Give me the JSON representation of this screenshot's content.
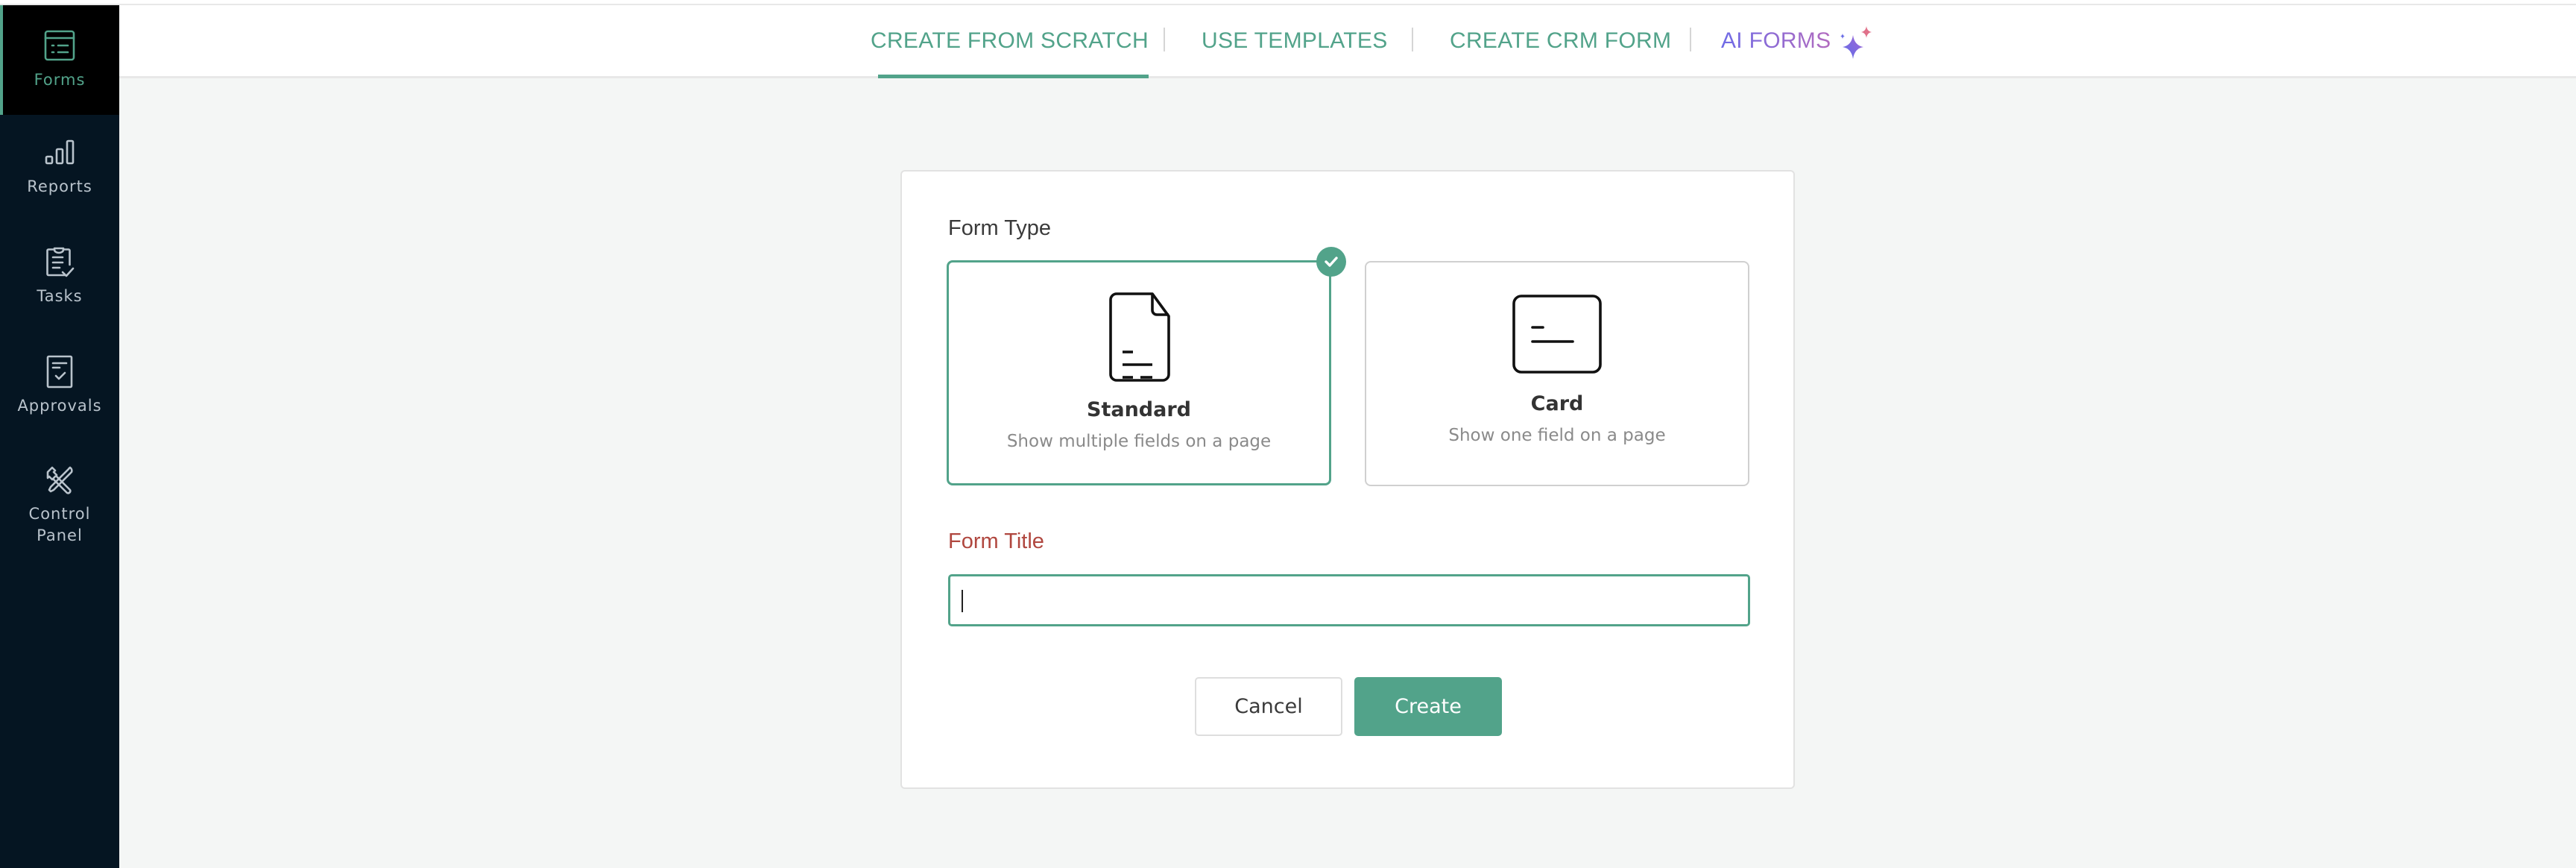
{
  "sidebar": {
    "items": [
      {
        "label": "Forms",
        "icon": "forms-icon",
        "active": true
      },
      {
        "label": "Reports",
        "icon": "bar-chart-icon",
        "active": false
      },
      {
        "label": "Tasks",
        "icon": "clipboard-check-icon",
        "active": false
      },
      {
        "label": "Approvals",
        "icon": "document-check-icon",
        "active": false
      },
      {
        "label": "Control\nPanel",
        "label_line1": "Control",
        "label_line2": "Panel",
        "icon": "tools-icon",
        "active": false
      }
    ]
  },
  "header": {
    "tabs": [
      {
        "label": "CREATE FROM SCRATCH",
        "active": true
      },
      {
        "label": "USE TEMPLATES",
        "active": false
      },
      {
        "label": "CREATE CRM FORM",
        "active": false
      },
      {
        "label": "AI FORMS",
        "active": false,
        "icon": "sparkle-icon"
      }
    ]
  },
  "form": {
    "form_type_label": "Form Type",
    "options": [
      {
        "title": "Standard",
        "description": "Show multiple fields on a page",
        "selected": true
      },
      {
        "title": "Card",
        "description": "Show one field on a page",
        "selected": false
      }
    ],
    "title_label": "Form Title",
    "title_value": "",
    "cancel_label": "Cancel",
    "create_label": "Create"
  },
  "colors": {
    "accent": "#52a38a",
    "sidebar_bg": "#051522",
    "error_label": "#b0473f",
    "ai_gradient_start": "#6f6be6",
    "ai_gradient_end": "#b26bbf"
  }
}
